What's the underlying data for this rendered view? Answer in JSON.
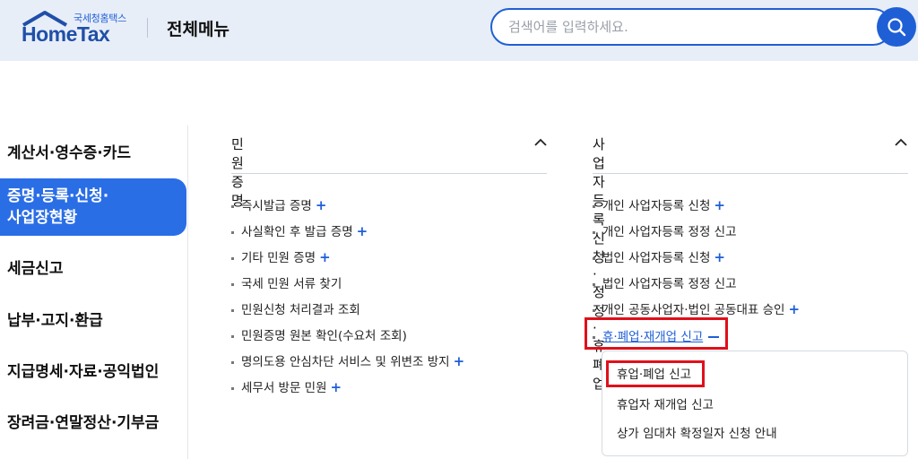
{
  "header": {
    "logo_sub": "국세청홈택스",
    "logo_main": "HomeTax",
    "title": "전체메뉴",
    "search_placeholder": "검색어를 입력하세요."
  },
  "leftnav": {
    "items": [
      {
        "label": "계산서·영수증·카드"
      },
      {
        "label_line1": "증명·등록·신청·",
        "label_line2": "사업장현황",
        "active": true
      },
      {
        "label": "세금신고"
      },
      {
        "label": "납부·고지·환급"
      },
      {
        "label": "지급명세·자료·공익법인"
      },
      {
        "label": "장려금·연말정산·기부금"
      }
    ]
  },
  "col1": {
    "heading": "민원증명",
    "items": [
      {
        "label": "즉시발급 증명",
        "expandable": true
      },
      {
        "label": "사실확인 후 발급 증명",
        "expandable": true
      },
      {
        "label": "기타 민원 증명",
        "expandable": true
      },
      {
        "label": "국세 민원 서류 찾기",
        "expandable": false
      },
      {
        "label": "민원신청 처리결과 조회",
        "expandable": false
      },
      {
        "label": "민원증명 원본 확인(수요처 조회)",
        "expandable": false
      },
      {
        "label": "명의도용 안심차단 서비스 및 위변조 방지",
        "expandable": true
      },
      {
        "label": "세무서 방문 민원",
        "expandable": true
      }
    ]
  },
  "col2": {
    "heading": "사업자등록 신청·정정·휴폐업",
    "items": [
      {
        "label": "개인 사업자등록 신청",
        "expandable": true
      },
      {
        "label": "개인 사업자등록 정정 신고",
        "expandable": false
      },
      {
        "label": "법인 사업자등록 신청",
        "expandable": true
      },
      {
        "label": "법인 사업자등록 정정 신고",
        "expandable": false
      },
      {
        "label": "개인 공동사업자·법인 공동대표 승인",
        "expandable": true
      },
      {
        "label": "휴·폐업·재개업 신고",
        "expanded": true
      }
    ],
    "submenu": [
      {
        "label": "휴업·폐업 신고"
      },
      {
        "label": "휴업자 재개업 신고"
      },
      {
        "label": "상가 임대차 확정일자 신청 안내"
      }
    ]
  },
  "plus_symbol": "+",
  "colors": {
    "accent": "#1f5fd6",
    "highlight": "#e0101a",
    "header_bg": "#e8eef8"
  }
}
